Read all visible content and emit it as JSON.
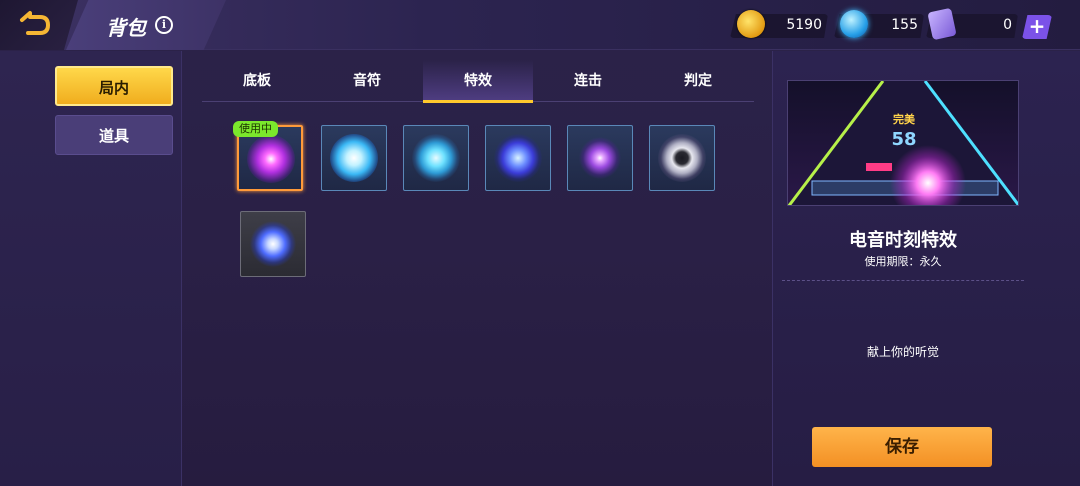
{
  "header": {
    "title": "背包",
    "info_icon": "info-icon"
  },
  "currency": {
    "coins": "5190",
    "gems": "155",
    "tickets": "0",
    "add_label": "+"
  },
  "sidebar": {
    "items": [
      {
        "label": "局内",
        "active": true
      },
      {
        "label": "道具",
        "active": false
      }
    ]
  },
  "tabs": [
    {
      "label": "底板"
    },
    {
      "label": "音符"
    },
    {
      "label": "特效",
      "active": true
    },
    {
      "label": "连击"
    },
    {
      "label": "判定"
    }
  ],
  "effects": {
    "in_use_badge": "使用中",
    "items": [
      {
        "icon": "purple-starburst-effect-icon",
        "selected": true
      },
      {
        "icon": "blue-orb-effect-icon"
      },
      {
        "icon": "blue-sparkle-effect-icon"
      },
      {
        "icon": "blue-disco-orb-effect-icon"
      },
      {
        "icon": "purple-star-flare-effect-icon"
      },
      {
        "icon": "white-ring-burst-effect-icon"
      },
      {
        "icon": "blue-flash-effect-icon"
      }
    ]
  },
  "preview": {
    "judgement": "完美",
    "combo": "58",
    "name": "电音时刻特效",
    "period": "使用期限：永久",
    "description": "献上你的听觉"
  },
  "actions": {
    "save_label": "保存"
  },
  "colors": {
    "accent": "#ffc92d",
    "save": "#f39024",
    "badge": "#7be82c"
  }
}
